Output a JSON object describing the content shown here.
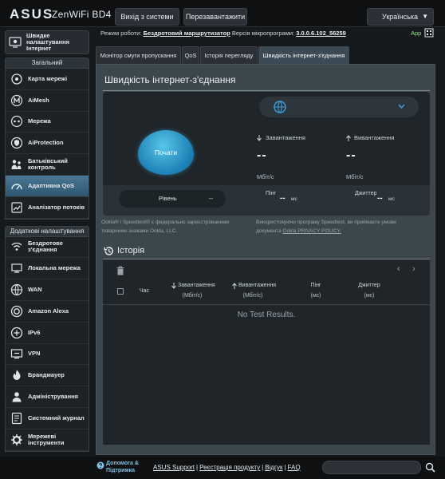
{
  "header": {
    "brand": "ASUS",
    "model": "ZenWiFi BD4",
    "logout_label": "Вихід з системи",
    "reboot_label": "Перезавантажити",
    "language": "Українська",
    "operation_mode_label": "Режим роботи:",
    "operation_mode_value": "Бездротовий маршрутизатор",
    "firmware_label": "Версія мікропрограми:",
    "firmware_value": "3.0.0.6.102_56259",
    "app_label": "App"
  },
  "sidebar": {
    "quick_setup": {
      "label_l1": "Швидке",
      "label_l2": "налаштування",
      "label_l3": "Інтернет",
      "icon": "quick-setup-icon"
    },
    "general_title": "Загальний",
    "general_items": [
      {
        "l1": "Карта мережі",
        "l2": "",
        "icon": "network-map-icon"
      },
      {
        "l1": "AiMesh",
        "l2": "",
        "icon": "aimesh-icon"
      },
      {
        "l1": "Мережа",
        "l2": "",
        "icon": "network-icon"
      },
      {
        "l1": "AiProtection",
        "l2": "",
        "icon": "shield-icon"
      },
      {
        "l1": "Батьківський",
        "l2": "контроль",
        "icon": "parental-control-icon"
      },
      {
        "l1": "Адаптивна QoS",
        "l2": "",
        "icon": "qos-icon",
        "active": true
      },
      {
        "l1": "Аналізатор потоків",
        "l2": "",
        "icon": "traffic-analyzer-icon"
      }
    ],
    "advanced_title": "Додаткові налаштування",
    "advanced_items": [
      {
        "l1": "Бездротове",
        "l2": "з'єднання",
        "icon": "wireless-icon"
      },
      {
        "l1": "Локальна мережа",
        "l2": "",
        "icon": "lan-icon"
      },
      {
        "l1": "WAN",
        "l2": "",
        "icon": "wan-icon"
      },
      {
        "l1": "Amazon Alexa",
        "l2": "",
        "icon": "alexa-icon"
      },
      {
        "l1": "IPv6",
        "l2": "",
        "icon": "ipv6-icon"
      },
      {
        "l1": "VPN",
        "l2": "",
        "icon": "vpn-icon"
      },
      {
        "l1": "Брандмауер",
        "l2": "",
        "icon": "firewall-icon"
      },
      {
        "l1": "Адміністрування",
        "l2": "",
        "icon": "administration-icon"
      },
      {
        "l1": "Системний журнал",
        "l2": "",
        "icon": "system-log-icon"
      },
      {
        "l1": "Мережеві",
        "l2": "інструменти",
        "icon": "network-tools-icon"
      }
    ]
  },
  "tabs": [
    {
      "label": "Монітор смуги пропускання",
      "active": false
    },
    {
      "label": "QoS",
      "active": false
    },
    {
      "label": "Історія перегляду",
      "active": false
    },
    {
      "label": "Швидкість інтернет-з'єднання",
      "active": true
    }
  ],
  "speedtest": {
    "title": "Швидкість інтернет-з'єднання",
    "start_label": "Почати",
    "download_label": "Завантаження",
    "upload_label": "Вивантаження",
    "download_value": "--",
    "upload_value": "--",
    "unit": "Мбіт/с",
    "level_label": "Рівень",
    "level_value": "--",
    "ping_label": "Пінг",
    "ping_value": "--",
    "ping_unit": "мс",
    "jitter_label": "Джиттер",
    "jitter_value": "--",
    "jitter_unit": "мс",
    "legal_left": "Ookla® і Speedtest® є федерально зареєстрованими товарними знаками Ookla, LLC.",
    "legal_right_prefix": "Використовуючи програму Speedtest, ви приймаєте умови документа",
    "legal_right_link": "Ookla PRIVACY POLICY."
  },
  "history": {
    "title": "Історія",
    "columns": [
      {
        "l1": "Час",
        "l2": ""
      },
      {
        "l1": "Завантаження",
        "l2": "(Мбіт/с)"
      },
      {
        "l1": "Вивантаження",
        "l2": "(Мбіт/с)"
      },
      {
        "l1": "Пінг",
        "l2": "(мс)"
      },
      {
        "l1": "Джиттер",
        "l2": "(мс)"
      }
    ],
    "empty_text": "No Test Results."
  },
  "footer": {
    "help_l1": "Допомога &",
    "help_l2": "Підтримка",
    "links": [
      "ASUS Support",
      "Реєстрація продукту",
      "Відгук",
      "FAQ"
    ],
    "search_placeholder": ""
  },
  "colors": {
    "accent": "#2f7fb3",
    "active_item": "#3b6d8c",
    "background": "#16191b"
  }
}
